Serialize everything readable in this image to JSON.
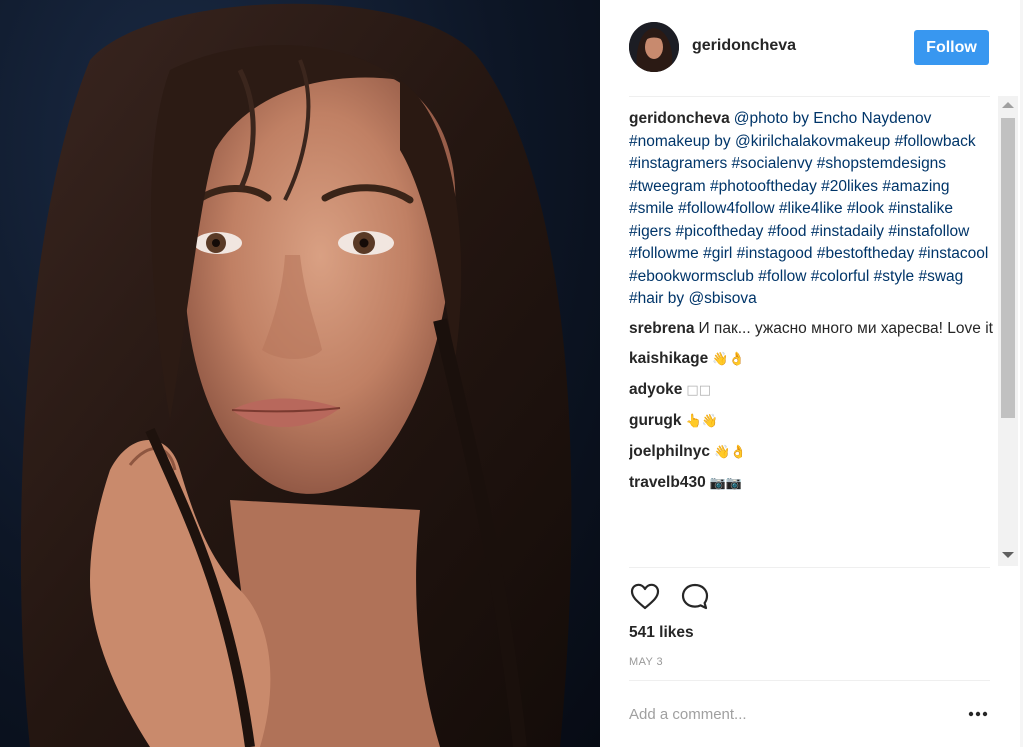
{
  "post": {
    "author": "geridoncheva",
    "follow_label": "Follow",
    "likes": "541 likes",
    "date": "MAY 3",
    "add_comment_placeholder": "Add a comment...",
    "caption": {
      "user": "geridoncheva",
      "text": "@photo by Encho Naydenov #nomakeup by @kirilchalakovmakeup #followback #instagramers #socialenvy #shopstemdesigns #tweegram #photooftheday #20likes #amazing #smile #follow4follow #like4like #look #instalike #igers #picoftheday #food #instadaily #instafollow #followme #girl #instagood #bestoftheday #instacool #ebookwormsclub #follow #colorful #style #swag #hair by @sbisova"
    },
    "comments": [
      {
        "user": "srebrena",
        "text": "И пак... ужасно много ми харесва! Love it"
      },
      {
        "user": "kaishikage",
        "text": "👋👌"
      },
      {
        "user": "adyoke",
        "text": "□□"
      },
      {
        "user": "gurugk",
        "text": "👆👋"
      },
      {
        "user": "joelphilnyc",
        "text": "👋👌"
      },
      {
        "user": "travelb430",
        "text": "📷📷"
      }
    ]
  },
  "icons": {
    "like": "heart-icon",
    "comment": "comment-bubble-icon",
    "more": "ellipsis-icon"
  },
  "colors": {
    "follow_button": "#3897f0",
    "caption_link": "#003569",
    "muted_text": "#999999"
  }
}
